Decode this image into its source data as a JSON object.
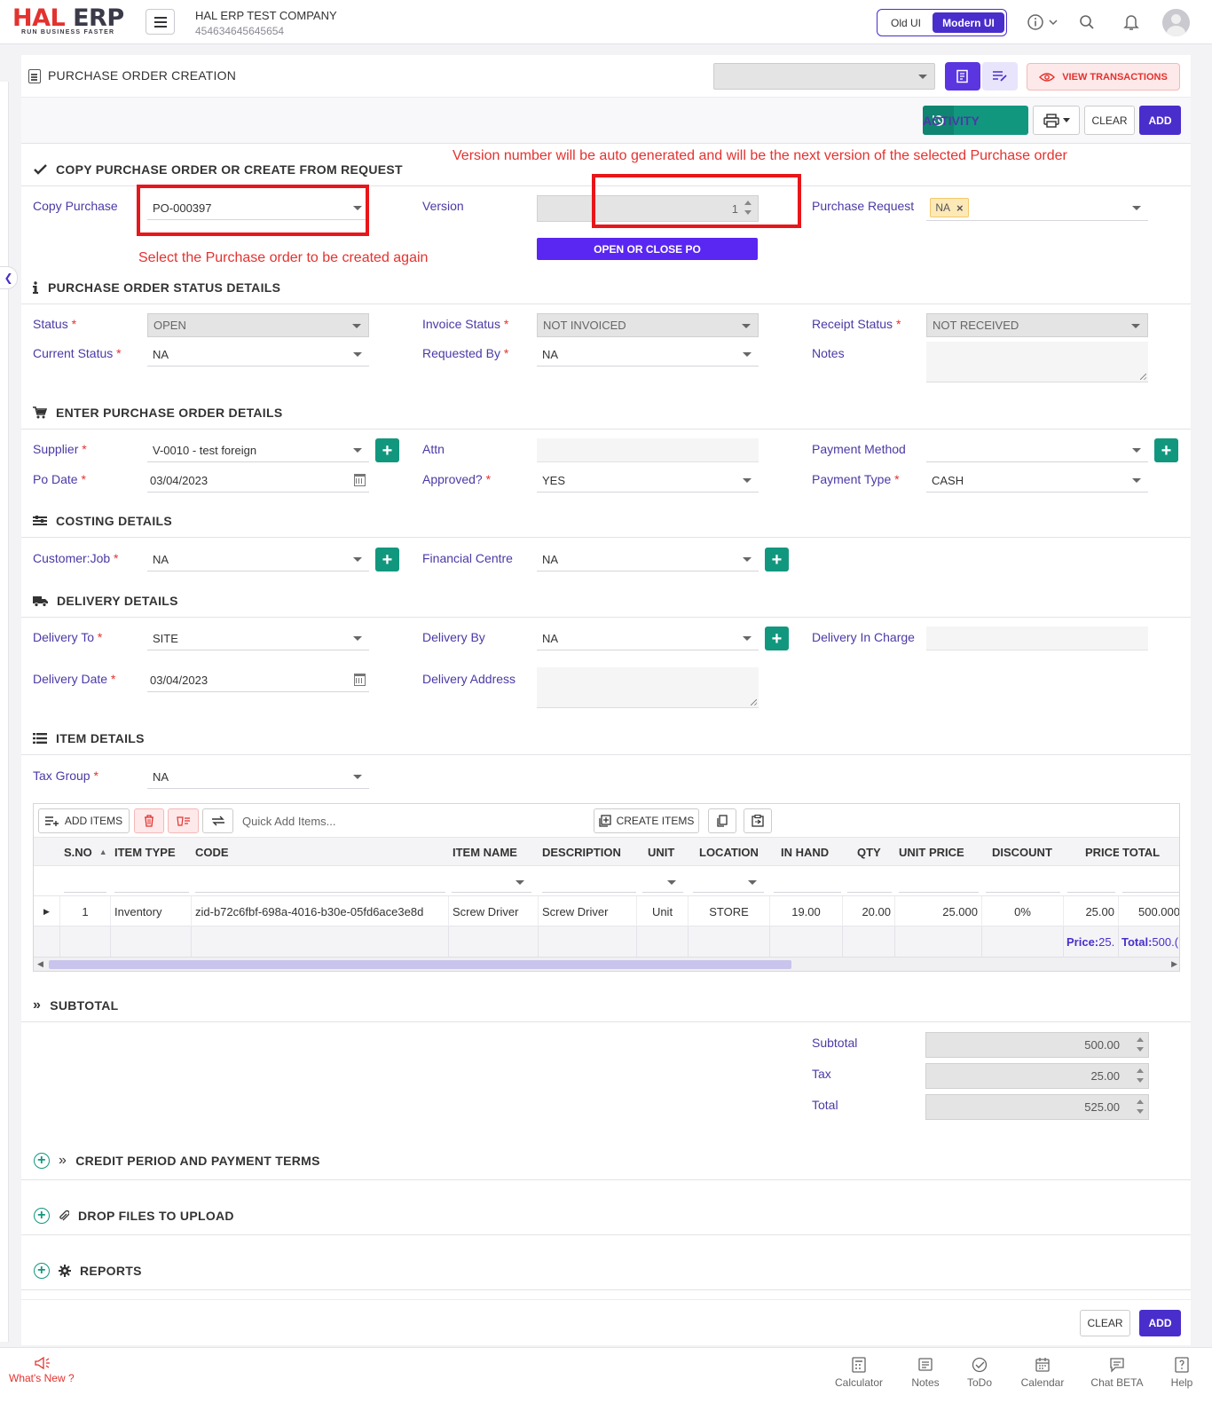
{
  "header": {
    "logo_main_a": "HAL",
    "logo_main_b": " ERP",
    "logo_tagline": "RUN BUSINESS FASTER",
    "company_name": "HAL ERP TEST COMPANY",
    "company_code": "454634645645654",
    "old_ui_label": "Old UI",
    "modern_ui_label": "Modern UI"
  },
  "page": {
    "title": "PURCHASE ORDER CREATION",
    "view_transactions_label": "VIEW TRANSACTIONS",
    "activity_label": "ACTIVITY",
    "clear_label": "CLEAR",
    "add_label": "ADD"
  },
  "annotations": {
    "version_note": "Version number will be auto generated and will be the next version of the selected Purchase order",
    "copy_note": "Select the Purchase order to be created again"
  },
  "copy_section": {
    "title": "COPY PURCHASE ORDER OR CREATE FROM REQUEST",
    "copy_purchase_label": "Copy Purchase",
    "copy_purchase_value": "PO-000397",
    "version_label": "Version",
    "version_value": "1",
    "open_close_label": "OPEN OR CLOSE PO",
    "purchase_request_label": "Purchase Request",
    "purchase_request_tag": "NA"
  },
  "status_section": {
    "title": "PURCHASE ORDER STATUS DETAILS",
    "status_label": "Status",
    "status_value": "OPEN",
    "invoice_status_label": "Invoice Status",
    "invoice_status_value": "NOT INVOICED",
    "receipt_status_label": "Receipt Status",
    "receipt_status_value": "NOT RECEIVED",
    "current_status_label": "Current Status",
    "current_status_value": "NA",
    "requested_by_label": "Requested By",
    "requested_by_value": "NA",
    "notes_label": "Notes"
  },
  "po_section": {
    "title": "ENTER PURCHASE ORDER DETAILS",
    "supplier_label": "Supplier",
    "supplier_value": "V-0010 - test foreign",
    "attn_label": "Attn",
    "payment_method_label": "Payment Method",
    "po_date_label": "Po Date",
    "po_date_value": "03/04/2023",
    "approved_label": "Approved?",
    "approved_value": "YES",
    "payment_type_label": "Payment Type",
    "payment_type_value": "CASH"
  },
  "costing_section": {
    "title": "COSTING DETAILS",
    "customer_job_label": "Customer:Job",
    "customer_job_value": "NA",
    "financial_centre_label": "Financial Centre",
    "financial_centre_value": "NA"
  },
  "delivery_section": {
    "title": "DELIVERY DETAILS",
    "delivery_to_label": "Delivery To",
    "delivery_to_value": "SITE",
    "delivery_by_label": "Delivery By",
    "delivery_by_value": "NA",
    "delivery_in_charge_label": "Delivery In Charge",
    "delivery_date_label": "Delivery Date",
    "delivery_date_value": "03/04/2023",
    "delivery_address_label": "Delivery Address"
  },
  "item_section": {
    "title": "ITEM DETAILS",
    "tax_group_label": "Tax Group",
    "tax_group_value": "NA",
    "add_items_label": "ADD ITEMS",
    "quick_add_placeholder": "Quick Add Items...",
    "create_items_label": "CREATE ITEMS",
    "columns": [
      "S.NO",
      "ITEM TYPE",
      "CODE",
      "ITEM NAME",
      "DESCRIPTION",
      "UNIT",
      "LOCATION",
      "IN HAND",
      "QTY",
      "UNIT PRICE",
      "DISCOUNT",
      "PRICE",
      "TOTAL"
    ],
    "rows": [
      [
        "1",
        "Inventory",
        "zid-b72c6fbf-698a-4016-b30e-05fd6ace3e8d",
        "Screw Driver",
        "Screw Driver",
        "Unit",
        "STORE",
        "19.00",
        "20.00",
        "25.000",
        "0%",
        "25.00",
        "500.000"
      ]
    ],
    "footer_price_label": "Price:",
    "footer_price_value": "25.",
    "footer_total_label": "Total:",
    "footer_total_value": "500.("
  },
  "subtotal_section": {
    "title": "SUBTOTAL",
    "subtotal_label": "Subtotal",
    "subtotal_value": "500.00",
    "tax_label": "Tax",
    "tax_value": "25.00",
    "total_label": "Total",
    "total_value": "525.00"
  },
  "collapsed_sections": {
    "credit": "CREDIT PERIOD AND PAYMENT TERMS",
    "files": "DROP FILES TO UPLOAD",
    "reports": "REPORTS"
  },
  "bottom_bar": {
    "whats_new": "What's New ?",
    "calculator": "Calculator",
    "notes": "Notes",
    "todo": "ToDo",
    "calendar": "Calendar",
    "chat": "Chat BETA",
    "help": "Help"
  },
  "colors": {
    "brand_red": "#e3322f",
    "primary_purple": "#4a2ecb",
    "teal": "#12977f",
    "annotation_red": "#e8161a"
  }
}
